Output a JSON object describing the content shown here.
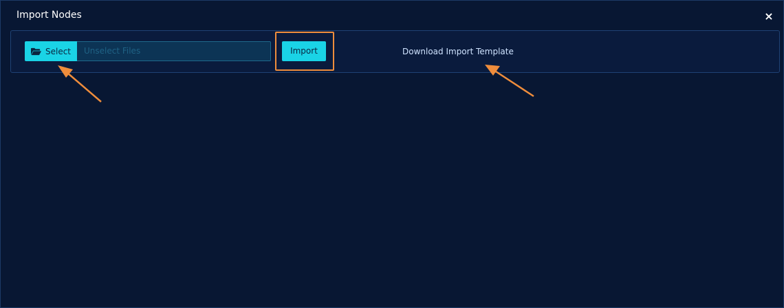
{
  "modal": {
    "title": "Import Nodes",
    "close_label": "×"
  },
  "importer": {
    "select_label": "Select",
    "file_placeholder": "Unselect Files",
    "import_label": "Import",
    "download_template_label": "Download Import Template"
  },
  "icons": {
    "folder": "folder-open-icon",
    "close": "close-icon"
  },
  "colors": {
    "background": "#081733",
    "accent": "#1ad3e6",
    "annotation": "#ef8d3c"
  }
}
